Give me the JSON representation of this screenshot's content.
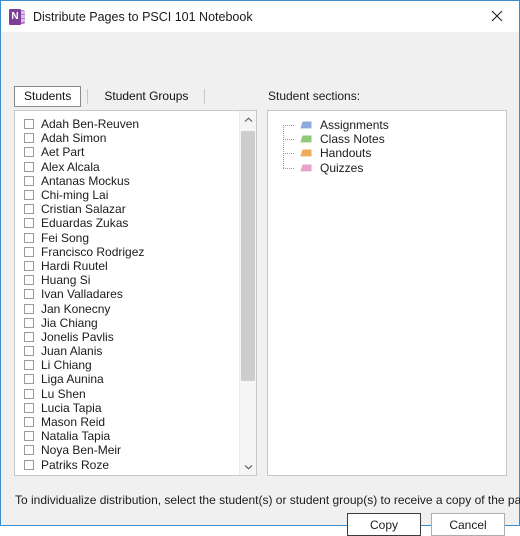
{
  "window": {
    "title": "Distribute Pages to PSCI 101 Notebook",
    "app_icon": "onenote-icon",
    "app_icon_letter": "N",
    "close_label": "Close",
    "border_color": "#3b8ed0"
  },
  "tabs": [
    {
      "label": "Students",
      "selected": true
    },
    {
      "label": "Student Groups",
      "selected": false
    }
  ],
  "students": [
    {
      "name": "Adah Ben-Reuven",
      "checked": false
    },
    {
      "name": "Adah Simon",
      "checked": false
    },
    {
      "name": "Aet Part",
      "checked": false
    },
    {
      "name": "Alex Alcala",
      "checked": false
    },
    {
      "name": "Antanas Mockus",
      "checked": false
    },
    {
      "name": "Chi-ming Lai",
      "checked": false
    },
    {
      "name": "Cristian Salazar",
      "checked": false
    },
    {
      "name": "Eduardas Zukas",
      "checked": false
    },
    {
      "name": "Fei Song",
      "checked": false
    },
    {
      "name": "Francisco Rodrigez",
      "checked": false
    },
    {
      "name": "Hardi Ruutel",
      "checked": false
    },
    {
      "name": "Huang Si",
      "checked": false
    },
    {
      "name": "Ivan Valladares",
      "checked": false
    },
    {
      "name": "Jan Konecny",
      "checked": false
    },
    {
      "name": "Jia Chiang",
      "checked": false
    },
    {
      "name": "Jonelis Pavlis",
      "checked": false
    },
    {
      "name": "Juan Alanis",
      "checked": false
    },
    {
      "name": "Li Chiang",
      "checked": false
    },
    {
      "name": "Liga Aunina",
      "checked": false
    },
    {
      "name": "Lu Shen",
      "checked": false
    },
    {
      "name": "Lucia Tapia",
      "checked": false
    },
    {
      "name": "Mason Reid",
      "checked": false
    },
    {
      "name": "Natalia Tapia",
      "checked": false
    },
    {
      "name": "Noya Ben-Meir",
      "checked": false
    },
    {
      "name": "Patriks Roze",
      "checked": false
    }
  ],
  "sections_panel": {
    "label": "Student sections:",
    "items": [
      {
        "name": "Assignments",
        "color": "#8ea9db",
        "icon": "section-tab-icon"
      },
      {
        "name": "Class Notes",
        "color": "#8fc87a",
        "icon": "section-tab-icon"
      },
      {
        "name": "Handouts",
        "color": "#f0ab5a",
        "icon": "section-tab-icon"
      },
      {
        "name": "Quizzes",
        "color": "#e9a3c9",
        "icon": "section-tab-icon"
      }
    ]
  },
  "scrollbar": {
    "up_arrow": "chevron-up-icon",
    "down_arrow": "chevron-down-icon"
  },
  "footer": {
    "hint": "To individualize distribution, select the student(s) or student group(s) to receive a copy of the page.",
    "copy_label": "Copy",
    "cancel_label": "Cancel"
  }
}
